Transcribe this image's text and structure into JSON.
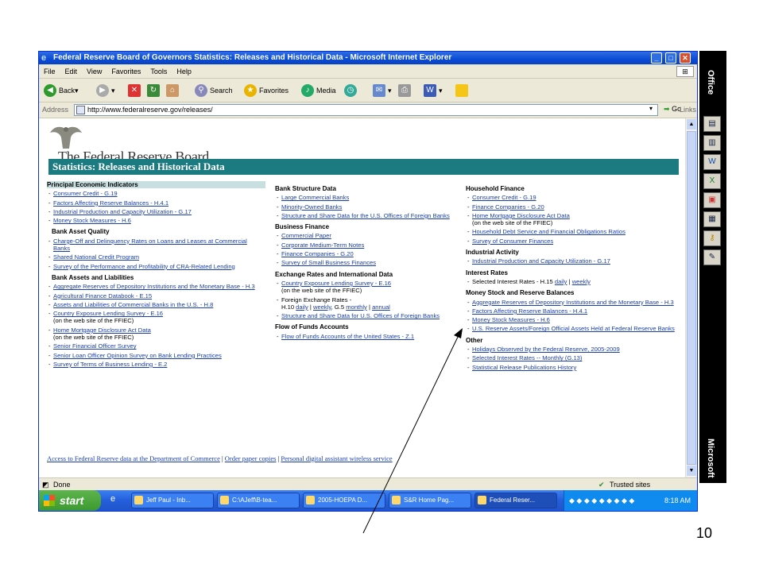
{
  "window": {
    "title": "Federal Reserve Board of Governors Statistics: Releases and Historical Data - Microsoft Internet Explorer"
  },
  "menu": [
    "File",
    "Edit",
    "View",
    "Favorites",
    "Tools",
    "Help"
  ],
  "toolbar": {
    "back": "Back",
    "search": "Search",
    "favorites": "Favorites",
    "media": "Media"
  },
  "address": {
    "label": "Address",
    "url": "http://www.federalreserve.gov/releases/",
    "go": "Go",
    "links": "Links"
  },
  "page": {
    "logo": "The Federal Reserve Board",
    "banner": "Statistics: Releases and Historical Data",
    "col1": [
      {
        "heading": "Principal Economic Indicators",
        "items": [
          {
            "link": "Consumer Credit - G.19"
          },
          {
            "link": "Factors Affecting Reserve Balances - H.4.1"
          },
          {
            "link": "Industrial Production and Capacity Utilization - G.17"
          },
          {
            "link": "Money Stock Measures - H.6"
          }
        ]
      },
      {
        "heading": "Bank Asset Quality",
        "items": [
          {
            "link": "Charge-Off and Delinquency Rates on Loans and Leases at Commercial Banks"
          },
          {
            "link": "Shared National Credit Program"
          },
          {
            "link": "Survey of the Performance and Profitability of CRA-Related Lending"
          }
        ]
      },
      {
        "heading": "Bank Assets and Liabilities",
        "items": [
          {
            "link": "Aggregate Reserves of Depository Institutions and the Monetary Base - H.3"
          },
          {
            "link": "Agricultural Finance Databook - E.15"
          },
          {
            "link": "Assets and Liabilities of Commercial Banks in the U.S. - H.8"
          },
          {
            "link": "Country Exposure Lending Survey - E.16",
            "note": "(on the web site of the FFIEC)"
          },
          {
            "link": "Home Mortgage Disclosure Act Data",
            "note": "(on the web site of the FFIEC)"
          },
          {
            "link": "Senior Financial Officer Survey"
          },
          {
            "link": "Senior Loan Officer Opinion Survey on Bank Lending Practices"
          },
          {
            "link": "Survey of Terms of Business Lending - E.2"
          }
        ]
      }
    ],
    "col2": [
      {
        "heading": "Bank Structure Data",
        "items": [
          {
            "link": "Large Commercial Banks"
          },
          {
            "link": "Minority-Owned Banks"
          },
          {
            "link": "Structure and Share Data for the U.S. Offices of Foreign Banks"
          }
        ]
      },
      {
        "heading": "Business Finance",
        "items": [
          {
            "link": "Commercial Paper"
          },
          {
            "link": "Corporate Medium-Term Notes"
          },
          {
            "link": "Finance Companies - G.20"
          },
          {
            "link": "Survey of Small Business Finances"
          }
        ]
      },
      {
        "heading": "Exchange Rates and International Data",
        "items": [
          {
            "link": "Country Exposure Lending Survey - E.16",
            "note": "(on the web site of the FFIEC)"
          },
          {
            "fx": true
          },
          {
            "link": "Structure and Share Data for U.S. Offices of Foreign Banks"
          }
        ]
      },
      {
        "heading": "Flow of Funds Accounts",
        "items": [
          {
            "link": "Flow of Funds Accounts of the United States - Z.1"
          }
        ]
      }
    ],
    "fx": {
      "line1": "Foreign Exchange Rates -",
      "h10": "H.10",
      "daily": "daily",
      "weekly": "weekly",
      "g5": "G.5",
      "monthly": "monthly",
      "annual": "annual"
    },
    "col3": [
      {
        "heading": "Household Finance",
        "items": [
          {
            "link": "Consumer Credit - G.19"
          },
          {
            "link": "Finance Companies - G.20"
          },
          {
            "link": "Home Mortgage Disclosure Act Data",
            "note": "(on the web site of the FFIEC)"
          },
          {
            "link": "Household Debt Service and Financial Obligations Ratios"
          },
          {
            "link": "Survey of Consumer Finances"
          }
        ]
      },
      {
        "heading": "Industrial Activity",
        "items": [
          {
            "link": "Industrial Production and Capacity Utilization - G.17"
          }
        ]
      },
      {
        "heading": "Interest Rates",
        "items": [
          {
            "ir": true
          }
        ]
      },
      {
        "heading": "Money Stock and Reserve Balances",
        "items": [
          {
            "link": "Aggregate Reserves of Depository Institutions and the Monetary Base - H.3"
          },
          {
            "link": "Factors Affecting Reserve Balances - H.4.1"
          },
          {
            "link": "Money Stock Measures - H.6"
          },
          {
            "link": "U.S. Reserve Assets/Foreign Official Assets Held at Federal Reserve Banks"
          }
        ]
      },
      {
        "heading": "Other",
        "items": [
          {
            "link": "Holidays Observed by the Federal Reserve, 2005-2009"
          },
          {
            "link": "Selected Interest Rates -- Monthly (G.13)"
          },
          {
            "link": "Statistical Release Publications History"
          }
        ]
      }
    ],
    "ir": {
      "text": "Selected Interest Rates - H.15",
      "daily": "daily",
      "weekly": "weekly"
    },
    "footer": [
      "Access to Federal Reserve data at the Department of Commerce",
      "Order paper copies",
      "Personal digital assistant wireless service"
    ]
  },
  "status": {
    "left": "Done",
    "zone": "Trusted sites"
  },
  "taskbar": {
    "start": "start",
    "tasks": [
      "Jeff Paul - Inb...",
      "C:\\AJeff\\B-tea...",
      "2005-HOEPA D...",
      "S&R Home Pag...",
      "Federal Reser..."
    ],
    "clock": "8:18 AM"
  },
  "office": {
    "top": "Office",
    "bottom": "Microsoft"
  },
  "slide_number": "10"
}
